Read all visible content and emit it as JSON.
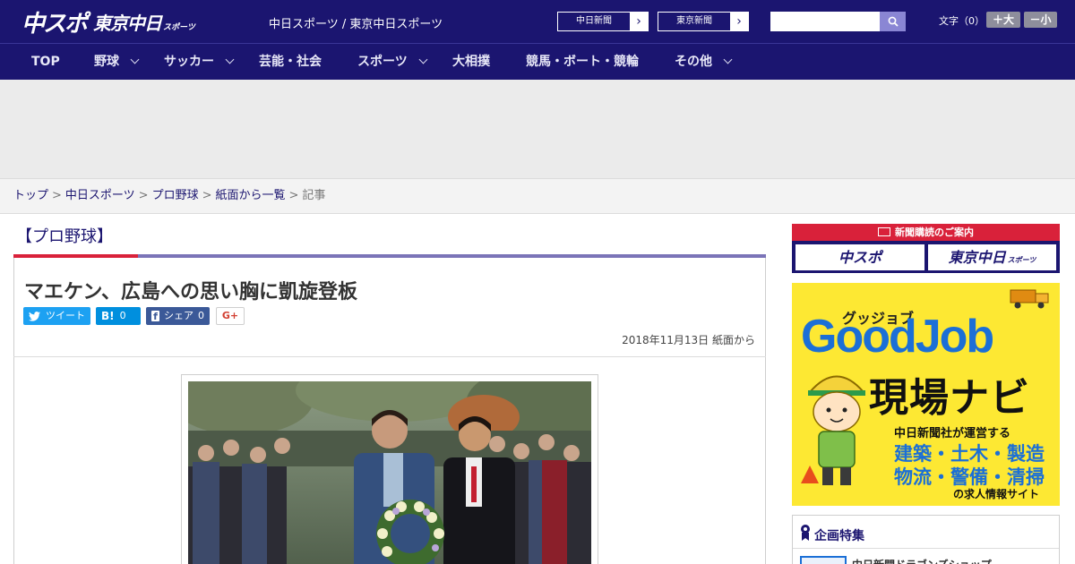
{
  "header": {
    "logo_main": "中スポ",
    "logo_sub": "東京中日",
    "logo_sub_small": "スポーツ",
    "tagline": "中日スポーツ / 東京中日スポーツ",
    "paper_links": [
      {
        "label": "中日新聞"
      },
      {
        "label": "東京新聞"
      }
    ],
    "search_placeholder": "",
    "font_size_label": "文字（0）",
    "font_larger": "＋大",
    "font_smaller": "－小"
  },
  "nav": {
    "items": [
      {
        "label": "TOP",
        "has_menu": false
      },
      {
        "label": "野球",
        "has_menu": true
      },
      {
        "label": "サッカー",
        "has_menu": true
      },
      {
        "label": "芸能・社会",
        "has_menu": false
      },
      {
        "label": "スポーツ",
        "has_menu": true
      },
      {
        "label": "大相撲",
        "has_menu": false
      },
      {
        "label": "競馬・ボート・競輪",
        "has_menu": false
      },
      {
        "label": "その他",
        "has_menu": true
      }
    ]
  },
  "breadcrumb": {
    "items": [
      "トップ",
      "中日スポーツ",
      "プロ野球",
      "紙面から一覧"
    ],
    "current": "記事",
    "separator": ">"
  },
  "article": {
    "section": "【プロ野球】",
    "headline": "マエケン、広島への思い胸に凱旋登板",
    "share": {
      "tweet_label": "ツイート",
      "hatena_icon": "B!",
      "hatena_count": "0",
      "facebook_label": "シェア",
      "facebook_count": "0",
      "gplus_label": "G+"
    },
    "dateline": "2018年11月13日 紙面から"
  },
  "sidebar": {
    "subscribe_title": "新聞購読のご案内",
    "subscribe_left": "中スポ",
    "subscribe_right": "東京中日",
    "subscribe_right_small": "スポーツ",
    "goodjob": {
      "kana": "グッジョブ",
      "title": "GoodJob",
      "subtitle": "現場ナビ",
      "operator": "中日新聞社が運営する",
      "line1": "建築・土木・製造",
      "line2": "物流・警備・清掃",
      "footer": "の求人情報サイト"
    },
    "feature_title": "企画特集",
    "feature_item": "中日新聞ドラゴンズショップ"
  },
  "colors": {
    "brand_navy": "#1b1570",
    "accent_red": "#d9213a",
    "goodjob_yellow": "#fde833",
    "goodjob_blue": "#1b6fd6"
  }
}
